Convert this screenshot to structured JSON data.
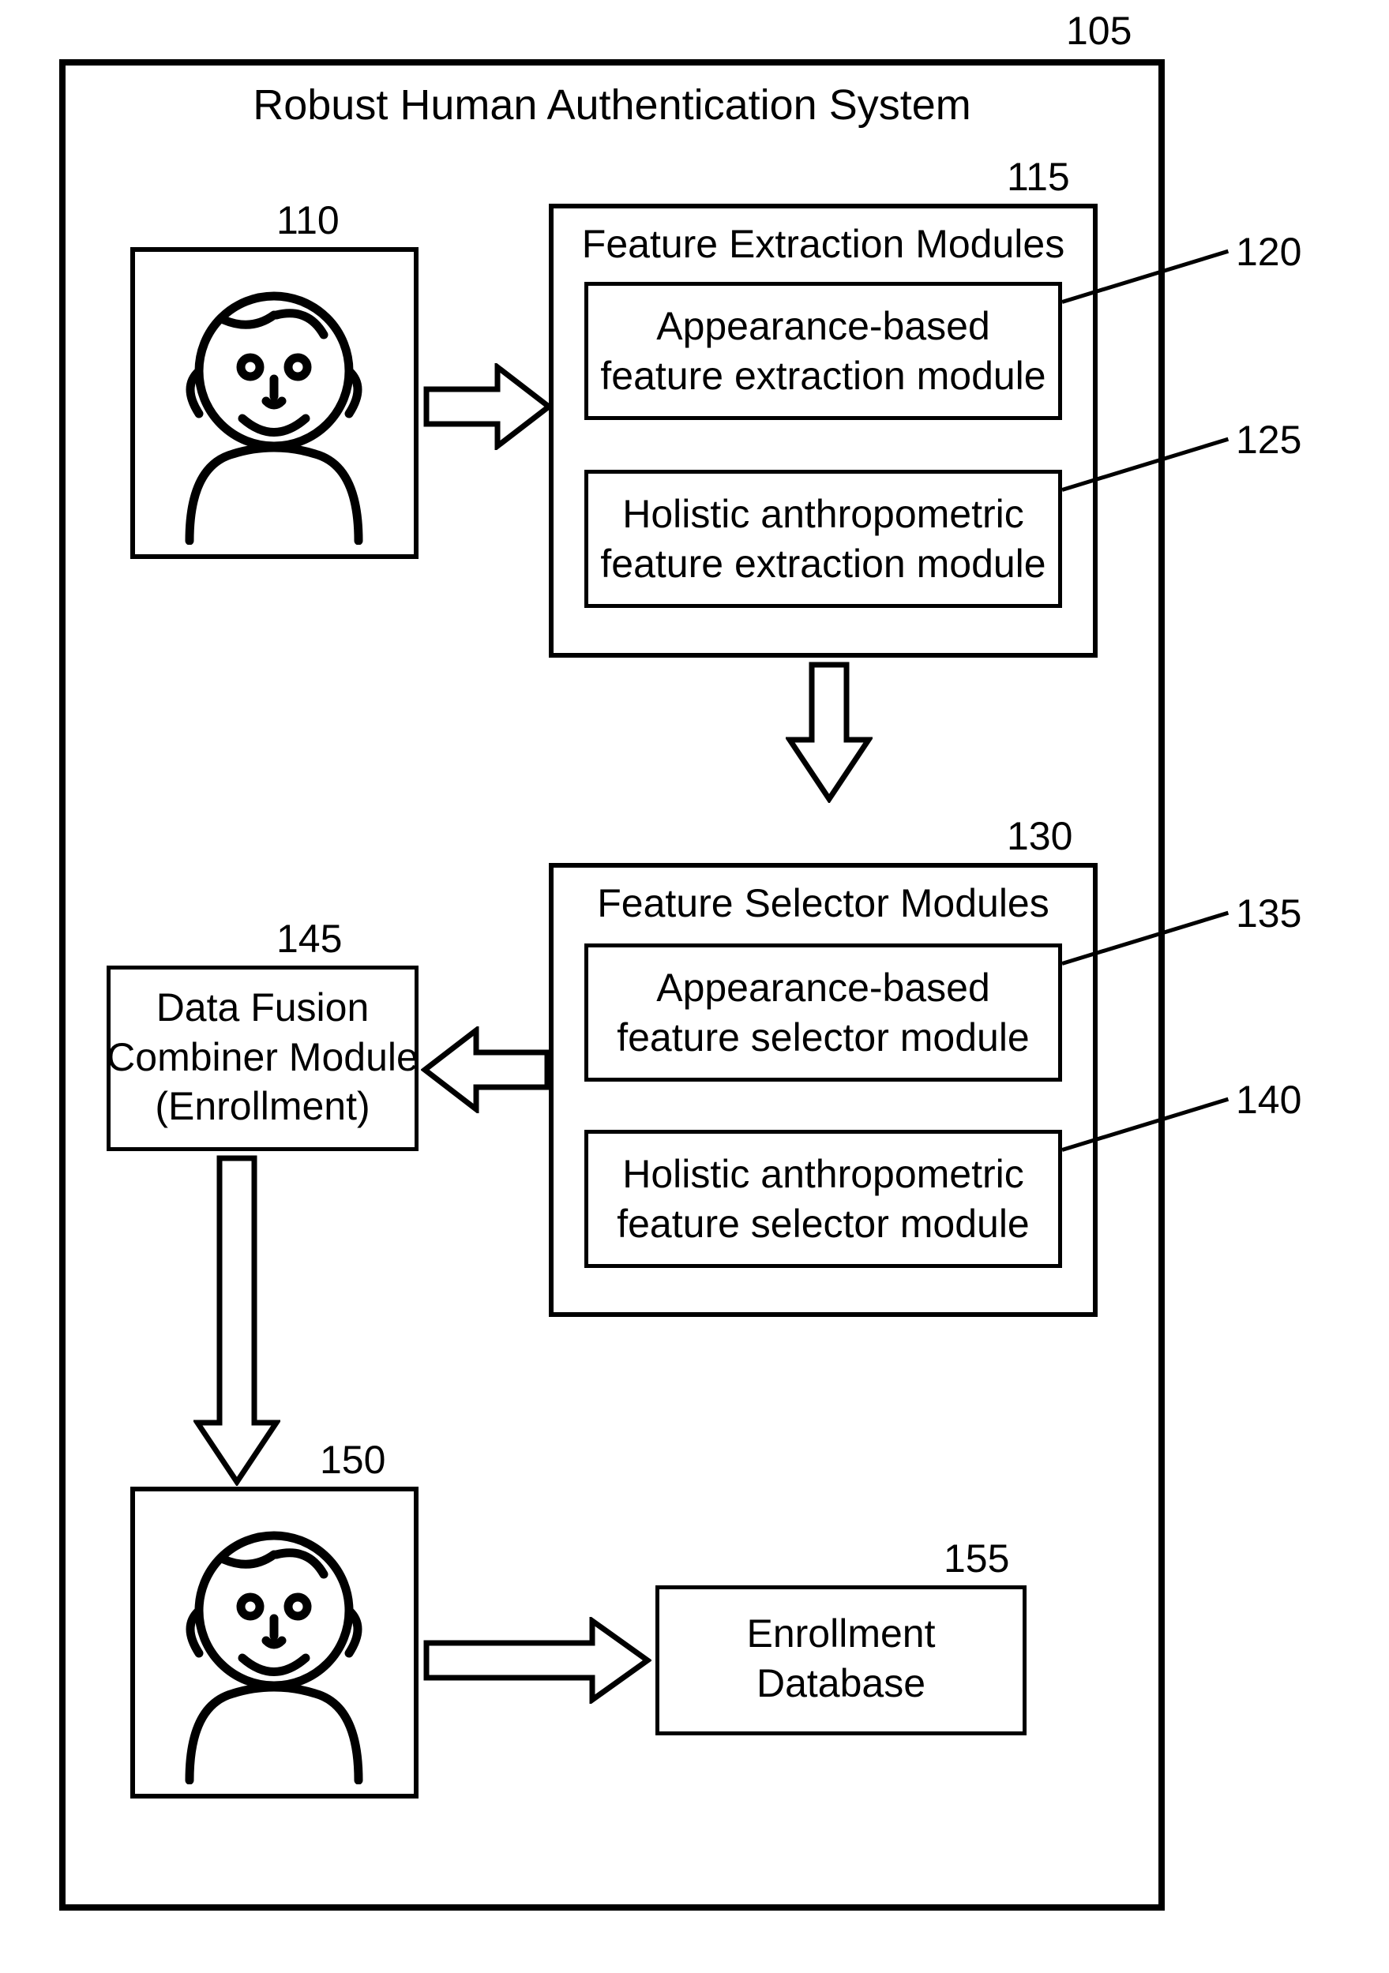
{
  "nums": {
    "n105": "105",
    "n110": "110",
    "n115": "115",
    "n120": "120",
    "n125": "125",
    "n130": "130",
    "n135": "135",
    "n140": "140",
    "n145": "145",
    "n150": "150",
    "n155": "155"
  },
  "titles": {
    "main": "Robust Human Authentication System",
    "feat_ext": "Feature Extraction Modules",
    "feat_sel": "Feature Selector Modules"
  },
  "modules": {
    "ext_app": "Appearance-based\nfeature extraction module",
    "ext_hol": "Holistic anthropometric\nfeature extraction module",
    "sel_app": "Appearance-based\nfeature selector module",
    "sel_hol": "Holistic anthropometric\nfeature selector module",
    "fusion": "Data Fusion\nCombiner Module\n(Enrollment)",
    "db": "Enrollment\nDatabase"
  }
}
